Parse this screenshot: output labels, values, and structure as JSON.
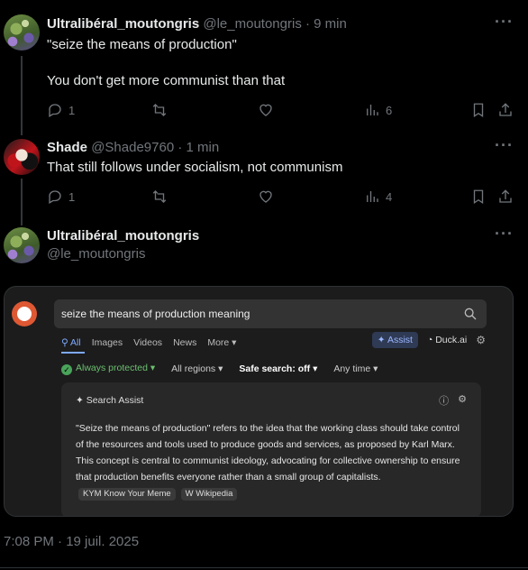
{
  "tweets": [
    {
      "name": "Ultralibéral_moutongris",
      "handle": "@le_moutongris",
      "time": "· 9 min",
      "lines": [
        "\"seize the means of production\"",
        "You don't get more communist than that"
      ],
      "replies": "1",
      "views": "6"
    },
    {
      "name": "Shade",
      "handle": "@Shade9760",
      "time": "· 1 min",
      "lines": [
        "That still follows under socialism, not communism"
      ],
      "replies": "1",
      "views": "4"
    }
  ],
  "main_tweet": {
    "name": "Ultralibéral_moutongris",
    "handle": "@le_moutongris",
    "timestamp": "7:08 PM · 19 juil. 2025"
  },
  "more_label": "···",
  "embedded": {
    "search_query": "seize the means of production meaning",
    "tabs": [
      "All",
      "Images",
      "Videos",
      "News",
      "More ▾"
    ],
    "assist_button": "Assist",
    "duck_ai": "Duck.ai",
    "filters": {
      "protected": "Always protected ▾",
      "regions": "All regions ▾",
      "safe_search": "Safe search: off ▾",
      "time": "Any time ▾"
    },
    "assist_title": "Search Assist",
    "assist_text": "\"Seize the means of production\" refers to the idea that the working class should take control of the resources and tools used to produce goods and services, as proposed by Karl Marx. This concept is central to communist ideology, advocating for collective ownership to ensure that production benefits everyone rather than a small group of capitalists.",
    "sources": [
      "KYM Know Your Meme",
      "W Wikipedia"
    ]
  }
}
